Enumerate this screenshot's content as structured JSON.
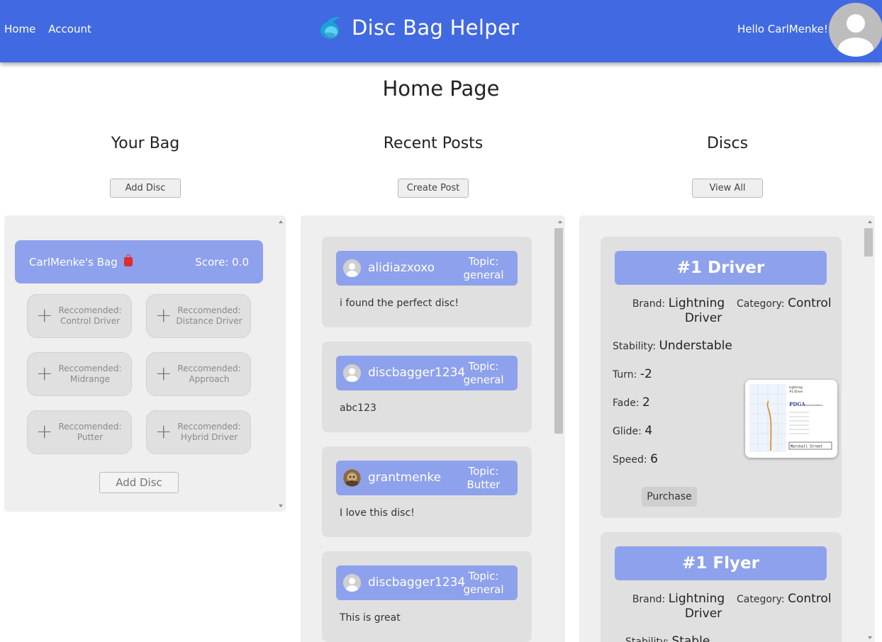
{
  "header": {
    "nav": [
      "Home",
      "Account"
    ],
    "title": "Disc Bag Helper",
    "greeting": "Hello CarlMenke!",
    "brand_color": "#4169e1"
  },
  "page_title": "Home Page",
  "bag": {
    "heading": "Your Bag",
    "add_button": "Add Disc",
    "name": "CarlMenke's Bag",
    "score": "Score: 0.0",
    "recommendations": [
      {
        "line1": "Reccomended:",
        "line2": "Control Driver"
      },
      {
        "line1": "Reccomended:",
        "line2": "Distance Driver"
      },
      {
        "line1": "Reccomended:",
        "line2": "Midrange"
      },
      {
        "line1": "Reccomended:",
        "line2": "Approach"
      },
      {
        "line1": "Reccomended:",
        "line2": "Putter"
      },
      {
        "line1": "Reccomended:",
        "line2": "Hybrid Driver"
      }
    ],
    "bottom_button": "Add Disc"
  },
  "posts": {
    "heading": "Recent Posts",
    "create_button": "Create Post",
    "items": [
      {
        "user": "alidiazxoxo",
        "topic_label": "Topic:",
        "topic": "general",
        "body": "i found the perfect disc!"
      },
      {
        "user": "discbagger1234",
        "topic_label": "Topic:",
        "topic": "general",
        "body": "abc123"
      },
      {
        "user": "grantmenke",
        "topic_label": "Topic:",
        "topic": "Butter",
        "body": "I love this disc!"
      },
      {
        "user": "discbagger1234",
        "topic_label": "Topic:",
        "topic": "general",
        "body": "This is great"
      }
    ]
  },
  "discs": {
    "heading": "Discs",
    "view_all_button": "View All",
    "items": [
      {
        "title": "#1 Driver",
        "brand_label": "Brand:",
        "brand": "Lightning",
        "brand2": "Driver",
        "category_label": "Category:",
        "category": "Control",
        "stability_label": "Stability:",
        "stability": "Understable",
        "turn_label": "Turn:",
        "turn": "-2",
        "fade_label": "Fade:",
        "fade": "2",
        "glide_label": "Glide:",
        "glide": "4",
        "speed_label": "Speed:",
        "speed": "6",
        "purchase": "Purchase",
        "spec_card": {
          "brand": "Lightning",
          "model": "#1 Driver",
          "logo": "PDGA",
          "specs_label": "Specifications",
          "footer": "Marshall Street"
        }
      },
      {
        "title": "#1 Flyer",
        "brand_label": "Brand:",
        "brand": "Lightning",
        "brand2": "Driver",
        "category_label": "Category:",
        "category": "Control",
        "stability_label": "Stability:",
        "stability": "Stable"
      }
    ]
  }
}
